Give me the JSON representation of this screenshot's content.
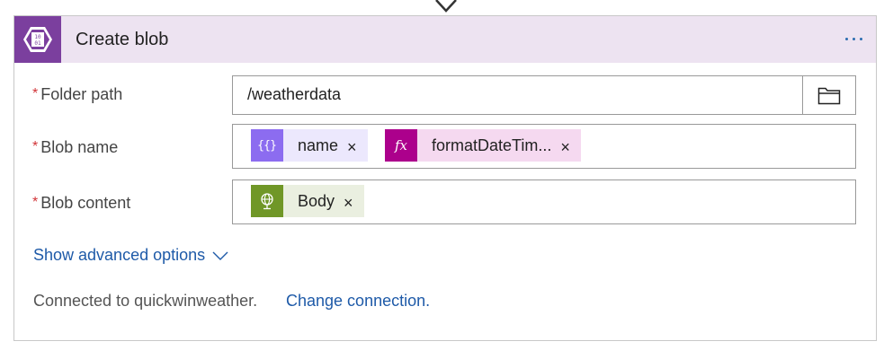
{
  "action": {
    "title": "Create blob",
    "icon": "azure-blob-storage-icon",
    "menu_icon": "more-options-icon",
    "header_bg": "#ede3f1",
    "icon_bg": "#7b3f9e"
  },
  "fields": {
    "folder_path": {
      "required_marker": "*",
      "label": "Folder path",
      "value": "/weatherdata",
      "browse_icon": "folder-icon"
    },
    "blob_name": {
      "required_marker": "*",
      "label": "Blob name",
      "tokens": [
        {
          "label": "name",
          "remove": "×",
          "icon": "variable-icon",
          "icon_bg": "#8c6cf0",
          "bg": "#ece8fd"
        },
        {
          "label": "formatDateTim...",
          "remove": "×",
          "icon": "expression-fx-icon",
          "icon_bg": "#ac008c",
          "bg": "#f5d9f0"
        }
      ]
    },
    "blob_content": {
      "required_marker": "*",
      "label": "Blob content",
      "tokens": [
        {
          "label": "Body",
          "remove": "×",
          "icon": "http-globe-icon",
          "icon_bg": "#709727",
          "bg": "#eaefe0"
        }
      ]
    }
  },
  "advanced": {
    "label": "Show advanced options",
    "icon": "chevron-down-icon"
  },
  "connection": {
    "text": "Connected to quickwinweather.",
    "change_label": "Change connection."
  },
  "colors": {
    "link": "#1e5aa8",
    "required": "#d13438"
  }
}
